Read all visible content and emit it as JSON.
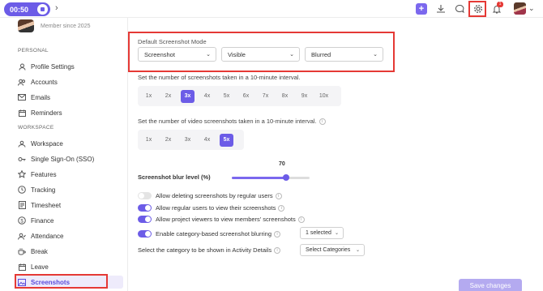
{
  "topbar": {
    "timer": "00:50",
    "notification_count": "1"
  },
  "profile": {
    "member_since": "Member since 2025"
  },
  "sidebar": {
    "personal_section": "PERSONAL",
    "workspace_section": "WORKSPACE",
    "personal_items": [
      {
        "label": "Profile Settings",
        "icon": "user-settings-icon"
      },
      {
        "label": "Accounts",
        "icon": "accounts-icon"
      },
      {
        "label": "Emails",
        "icon": "mail-icon"
      },
      {
        "label": "Reminders",
        "icon": "reminder-icon"
      }
    ],
    "workspace_items": [
      {
        "label": "Workspace",
        "icon": "workspace-icon"
      },
      {
        "label": "Single Sign-On (SSO)",
        "icon": "key-icon"
      },
      {
        "label": "Features",
        "icon": "star-icon"
      },
      {
        "label": "Tracking",
        "icon": "clock-icon"
      },
      {
        "label": "Timesheet",
        "icon": "timesheet-icon"
      },
      {
        "label": "Finance",
        "icon": "dollar-icon"
      },
      {
        "label": "Attendance",
        "icon": "attendance-icon"
      },
      {
        "label": "Break",
        "icon": "coffee-icon"
      },
      {
        "label": "Leave",
        "icon": "leave-icon"
      },
      {
        "label": "Screenshots",
        "icon": "image-icon"
      }
    ]
  },
  "main": {
    "default_mode_label": "Default Screenshot Mode",
    "mode_selects": [
      "Screenshot",
      "Visible",
      "Blurred"
    ],
    "screenshots_question": "Set the number of screenshots taken in a 10-minute interval.",
    "screenshot_options": [
      "1x",
      "2x",
      "3x",
      "4x",
      "5x",
      "6x",
      "7x",
      "8x",
      "9x",
      "10x"
    ],
    "screenshot_selected": "3x",
    "video_question": "Set the number of video screenshots taken in a 10-minute interval.",
    "video_options": [
      "1x",
      "2x",
      "3x",
      "4x",
      "5x"
    ],
    "video_selected": "5x",
    "blur_label": "Screenshot blur level (%)",
    "blur_value": "70",
    "blur_level": 70,
    "toggles": [
      {
        "label": "Allow deleting screenshots by regular users",
        "on": false
      },
      {
        "label": "Allow regular users to view their screenshots",
        "on": true
      },
      {
        "label": "Allow project viewers to view members' screenshots",
        "on": true
      },
      {
        "label": "Enable category-based screenshot blurring",
        "on": true
      }
    ],
    "category_blur_select": "1 selected",
    "category_activity_label": "Select the category to be shown in Activity Details",
    "category_activity_select": "Select Categories",
    "save_label": "Save changes"
  },
  "colors": {
    "accent": "#6c5ce7",
    "highlight": "#e53935"
  }
}
